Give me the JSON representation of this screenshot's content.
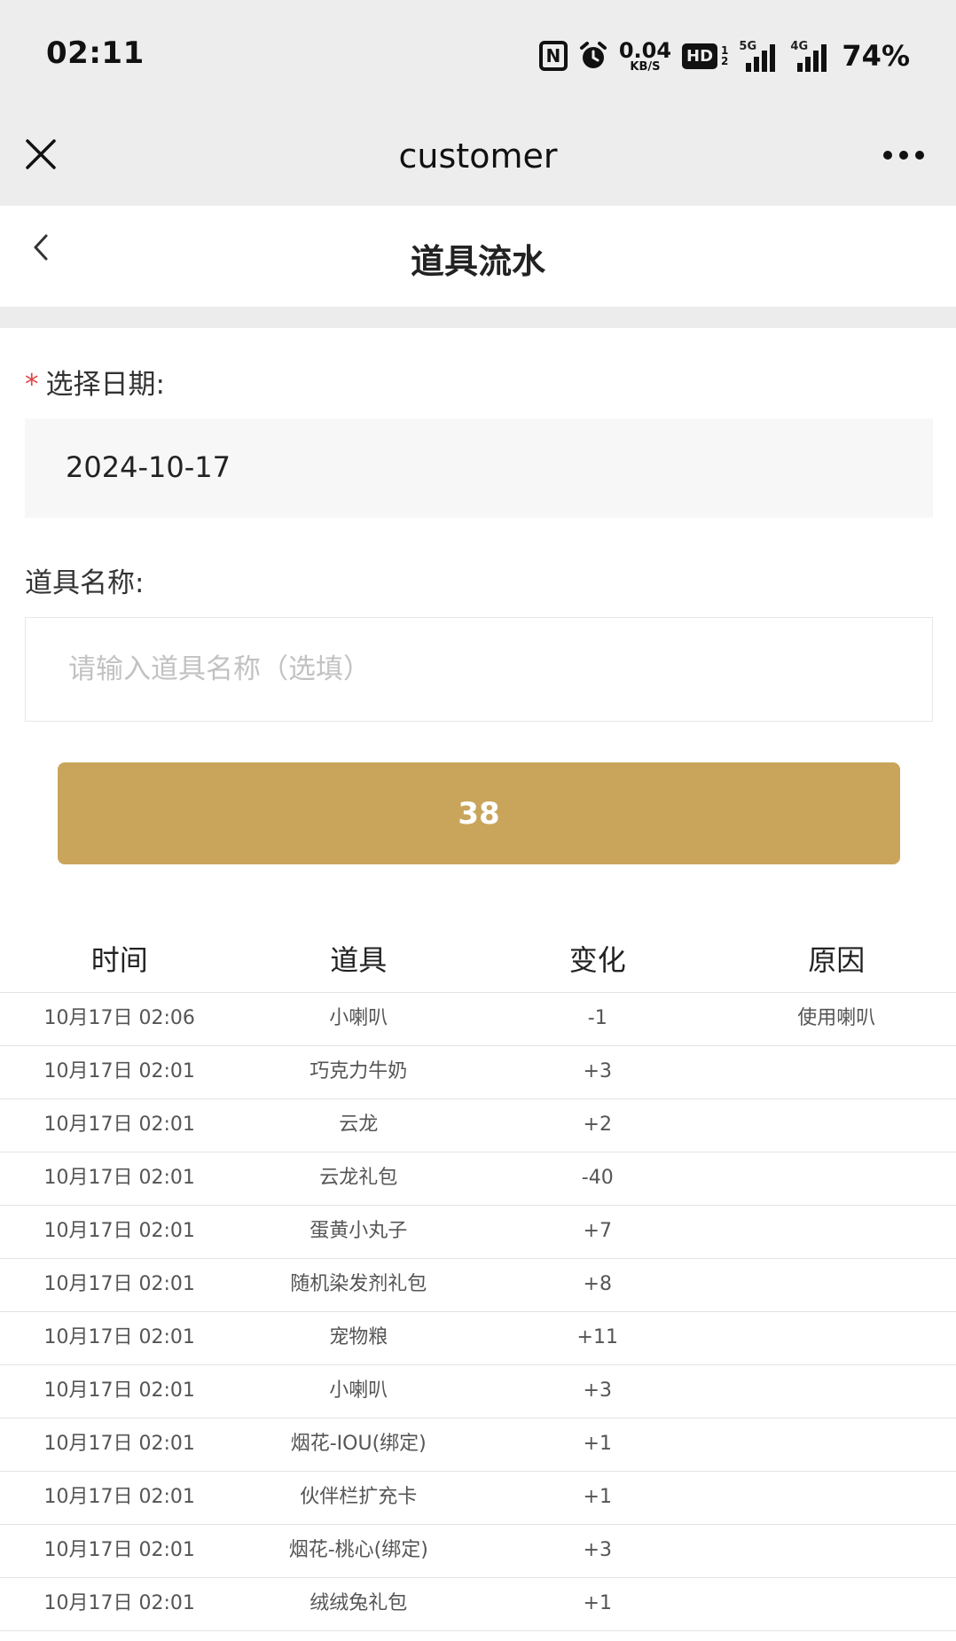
{
  "status_bar": {
    "time": "02:11",
    "nfc": "N",
    "net_speed": "0.04",
    "net_unit": "KB/S",
    "hd_label": "HD",
    "hd_sub1": "1",
    "hd_sub2": "2",
    "signal1_label": "5G",
    "signal2_label": "4G",
    "battery": "74%"
  },
  "titlebar": {
    "title": "customer"
  },
  "page": {
    "title": "道具流水"
  },
  "form": {
    "required_mark": "*",
    "date_label": "选择日期:",
    "date_value": "2024-10-17",
    "name_label": "道具名称:",
    "name_placeholder": "请输入道具名称（选填）",
    "name_value": "",
    "submit_label": "38"
  },
  "table": {
    "headers": [
      "时间",
      "道具",
      "变化",
      "原因"
    ],
    "rows": [
      {
        "time": "10月17日 02:06",
        "item": "小喇叭",
        "change": "-1",
        "reason": "使用喇叭"
      },
      {
        "time": "10月17日 02:01",
        "item": "巧克力牛奶",
        "change": "+3",
        "reason": ""
      },
      {
        "time": "10月17日 02:01",
        "item": "云龙",
        "change": "+2",
        "reason": ""
      },
      {
        "time": "10月17日 02:01",
        "item": "云龙礼包",
        "change": "-40",
        "reason": ""
      },
      {
        "time": "10月17日 02:01",
        "item": "蛋黄小丸子",
        "change": "+7",
        "reason": ""
      },
      {
        "time": "10月17日 02:01",
        "item": "随机染发剂礼包",
        "change": "+8",
        "reason": ""
      },
      {
        "time": "10月17日 02:01",
        "item": "宠物粮",
        "change": "+11",
        "reason": ""
      },
      {
        "time": "10月17日 02:01",
        "item": "小喇叭",
        "change": "+3",
        "reason": ""
      },
      {
        "time": "10月17日 02:01",
        "item": "烟花-IOU(绑定)",
        "change": "+1",
        "reason": ""
      },
      {
        "time": "10月17日 02:01",
        "item": "伙伴栏扩充卡",
        "change": "+1",
        "reason": ""
      },
      {
        "time": "10月17日 02:01",
        "item": "烟花-桃心(绑定)",
        "change": "+3",
        "reason": ""
      },
      {
        "time": "10月17日 02:01",
        "item": "绒绒兔礼包",
        "change": "+1",
        "reason": ""
      }
    ]
  },
  "colors": {
    "accent": "#c9a55c",
    "required": "#e04545",
    "bar_bg": "#ededed"
  }
}
